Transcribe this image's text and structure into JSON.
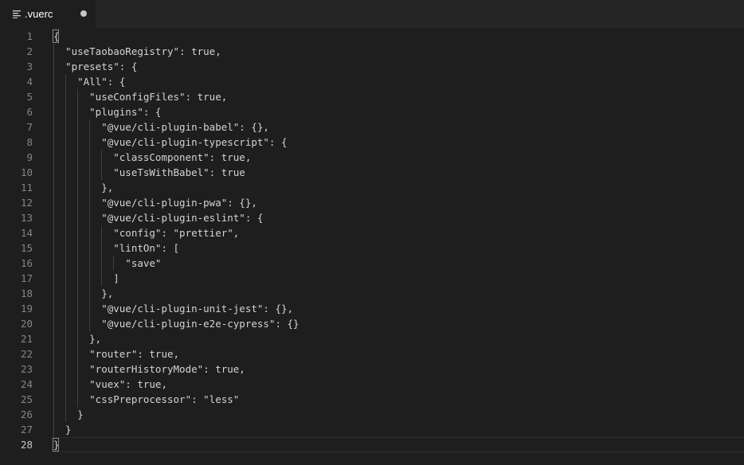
{
  "tab": {
    "filename": ".vuerc",
    "icon": "file-lines-icon",
    "dirty": true
  },
  "editor": {
    "current_line": 28,
    "lines": [
      {
        "n": "1",
        "text": "{"
      },
      {
        "n": "2",
        "text": "  \"useTaobaoRegistry\": true,"
      },
      {
        "n": "3",
        "text": "  \"presets\": {"
      },
      {
        "n": "4",
        "text": "    \"All\": {"
      },
      {
        "n": "5",
        "text": "      \"useConfigFiles\": true,"
      },
      {
        "n": "6",
        "text": "      \"plugins\": {"
      },
      {
        "n": "7",
        "text": "        \"@vue/cli-plugin-babel\": {},"
      },
      {
        "n": "8",
        "text": "        \"@vue/cli-plugin-typescript\": {"
      },
      {
        "n": "9",
        "text": "          \"classComponent\": true,"
      },
      {
        "n": "10",
        "text": "          \"useTsWithBabel\": true"
      },
      {
        "n": "11",
        "text": "        },"
      },
      {
        "n": "12",
        "text": "        \"@vue/cli-plugin-pwa\": {},"
      },
      {
        "n": "13",
        "text": "        \"@vue/cli-plugin-eslint\": {"
      },
      {
        "n": "14",
        "text": "          \"config\": \"prettier\","
      },
      {
        "n": "15",
        "text": "          \"lintOn\": ["
      },
      {
        "n": "16",
        "text": "            \"save\""
      },
      {
        "n": "17",
        "text": "          ]"
      },
      {
        "n": "18",
        "text": "        },"
      },
      {
        "n": "19",
        "text": "        \"@vue/cli-plugin-unit-jest\": {},"
      },
      {
        "n": "20",
        "text": "        \"@vue/cli-plugin-e2e-cypress\": {}"
      },
      {
        "n": "21",
        "text": "      },"
      },
      {
        "n": "22",
        "text": "      \"router\": true,"
      },
      {
        "n": "23",
        "text": "      \"routerHistoryMode\": true,"
      },
      {
        "n": "24",
        "text": "      \"vuex\": true,"
      },
      {
        "n": "25",
        "text": "      \"cssPreprocessor\": \"less\""
      },
      {
        "n": "26",
        "text": "    }"
      },
      {
        "n": "27",
        "text": "  }"
      },
      {
        "n": "28",
        "text": "}"
      }
    ]
  },
  "colors": {
    "background": "#1e1e1e",
    "tabbar": "#252526",
    "line_number": "#858585",
    "line_number_active": "#c6c6c6",
    "text": "#d4d4d4",
    "indent_guide": "#404040"
  }
}
